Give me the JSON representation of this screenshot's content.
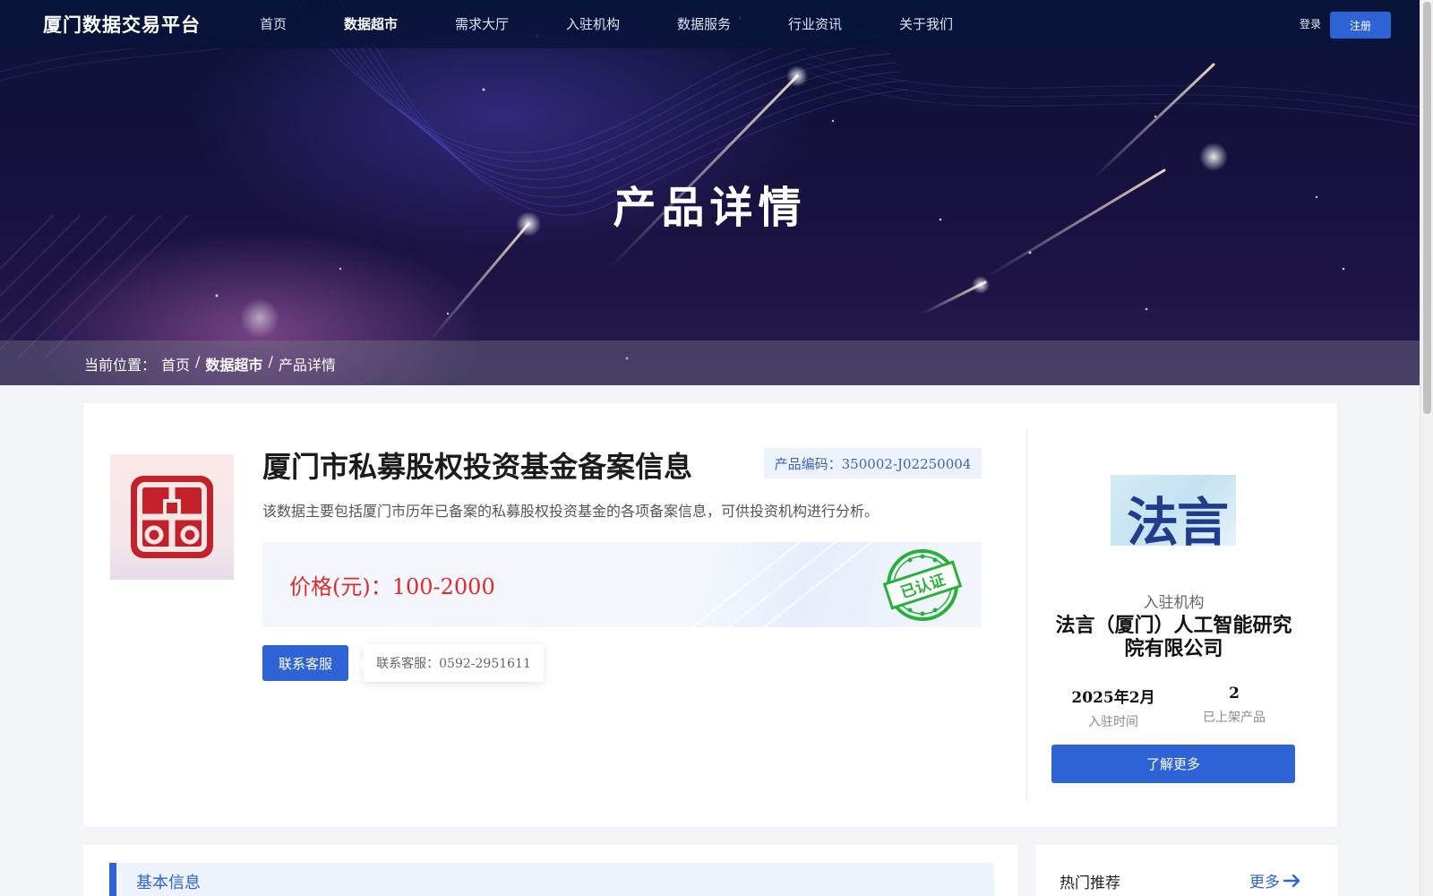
{
  "nav": {
    "logo": "厦门数据交易平台",
    "items": [
      {
        "label": "首页"
      },
      {
        "label": "数据超市"
      },
      {
        "label": "需求大厅"
      },
      {
        "label": "入驻机构"
      },
      {
        "label": "数据服务"
      },
      {
        "label": "行业资讯"
      },
      {
        "label": "关于我们"
      }
    ],
    "active_item": "数据超市",
    "login": "登录",
    "register": "注册"
  },
  "hero": {
    "title": "产品详情"
  },
  "breadcrumb": {
    "prefix": "当前位置：",
    "items": [
      "首页",
      "数据超市",
      "产品详情"
    ],
    "separator": "/"
  },
  "product": {
    "title": "厦门市私募股权投资基金备案信息",
    "code": "产品编码：350002-J02250004",
    "description": "该数据主要包括厦门市历年已备案的私募股权投资基金的各项备案信息，可供投资机构进行分析。",
    "price": "价格(元)：100-2000",
    "certified_stamp": "已认证",
    "contact_button": "联系客服",
    "contact_tip": "联系客服：0592-2951611"
  },
  "org": {
    "logo_text": "法言",
    "label": "入驻机构",
    "name": "法言（厦门）人工智能研究院有限公司",
    "stats": [
      {
        "value": "2025年2月",
        "label": "入驻时间"
      },
      {
        "value": "2",
        "label": "已上架产品"
      }
    ],
    "more_button": "了解更多"
  },
  "basic_info": {
    "title": "基本信息"
  },
  "hot": {
    "title": "热门推荐",
    "more": "更多"
  },
  "colors": {
    "primary": "#2e63d6",
    "price": "#e02b2b",
    "stamp": "#27b03a",
    "hero_bg": "#15113d"
  }
}
